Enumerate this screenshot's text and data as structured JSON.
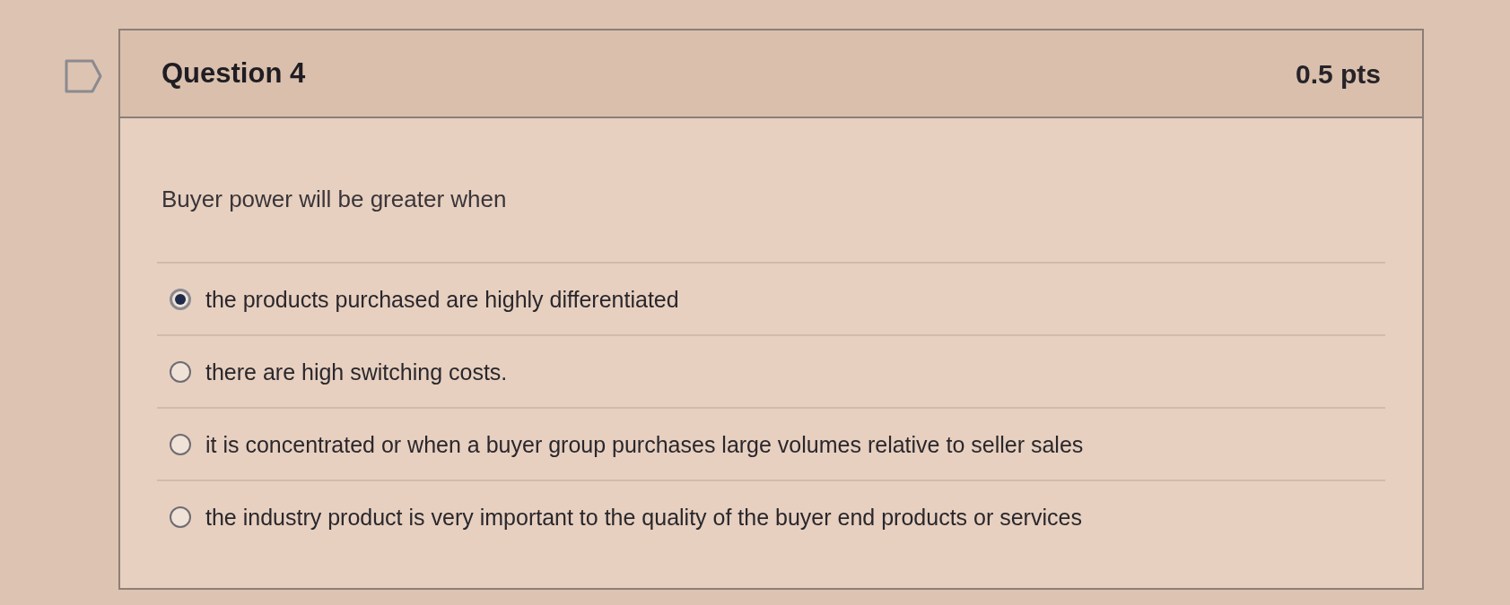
{
  "question": {
    "flagged": false,
    "title": "Question 4",
    "points": "0.5 pts"
  },
  "prompt": "Buyer power will be greater when",
  "answers": [
    {
      "label": "the products purchased are highly differentiated",
      "selected": true
    },
    {
      "label": "there are high switching costs.",
      "selected": false
    },
    {
      "label": "it is concentrated or when a buyer group purchases large volumes relative to seller sales",
      "selected": false
    },
    {
      "label": "the industry product is very important to the quality of the buyer end products or services",
      "selected": false
    }
  ]
}
